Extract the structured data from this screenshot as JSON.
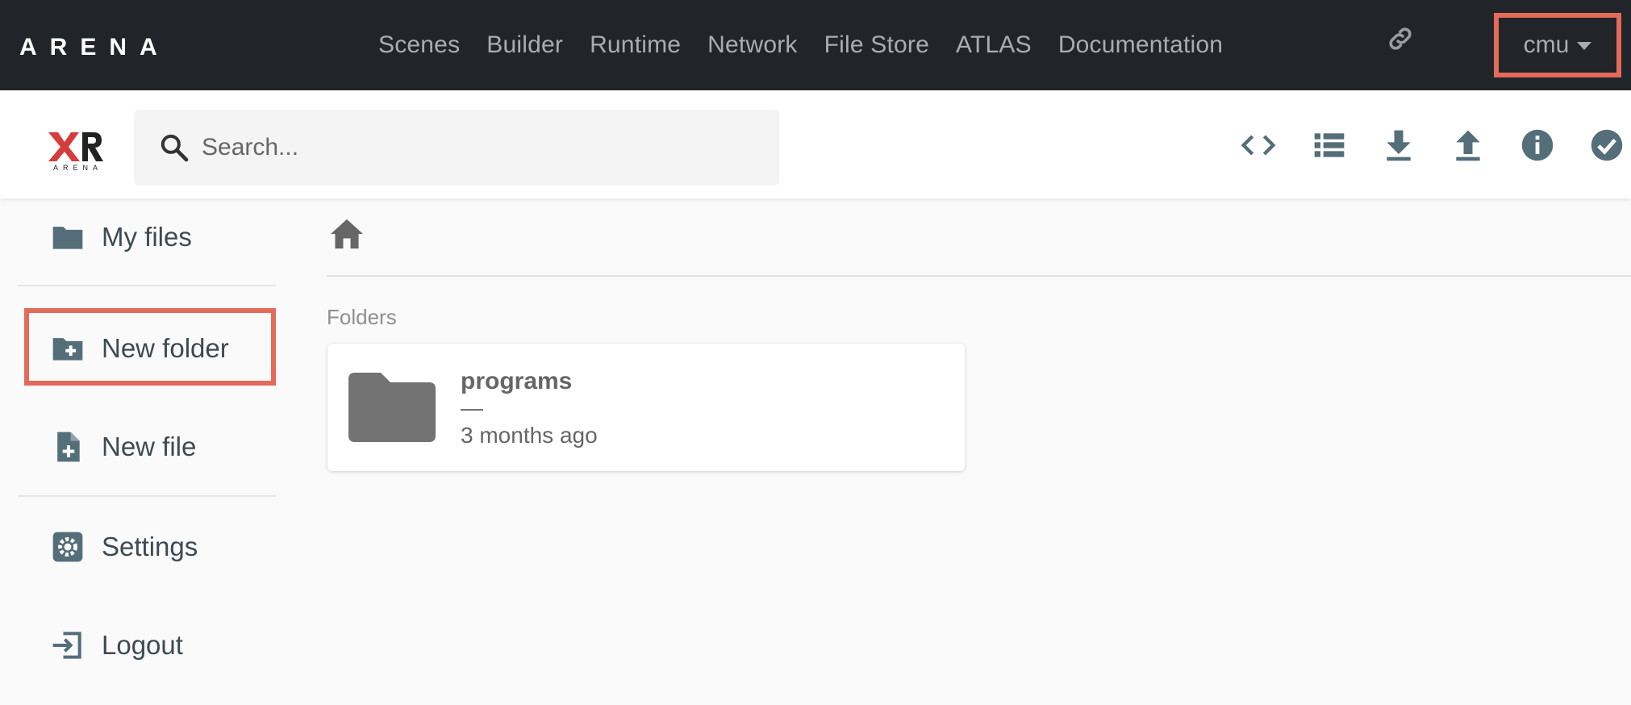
{
  "topnav": {
    "brand": "ARENA",
    "links": [
      "Scenes",
      "Builder",
      "Runtime",
      "Network",
      "File Store",
      "ATLAS",
      "Documentation"
    ],
    "user": "cmu",
    "icons": {
      "link": "link-icon",
      "caret": "caret-down-icon"
    }
  },
  "header": {
    "logo": "XR ARENA",
    "search": {
      "placeholder": "Search...",
      "value": ""
    },
    "toolbar_icons": [
      "code-icon",
      "list-view-icon",
      "download-icon",
      "upload-icon",
      "info-icon",
      "check-circle-icon"
    ]
  },
  "sidebar": {
    "items": [
      {
        "label": "My files",
        "icon": "folder-icon"
      },
      {
        "label": "New folder",
        "icon": "create-folder-icon"
      },
      {
        "label": "New file",
        "icon": "note-add-icon"
      },
      {
        "label": "Settings",
        "icon": "settings-icon"
      },
      {
        "label": "Logout",
        "icon": "logout-icon"
      }
    ]
  },
  "main": {
    "breadcrumb_icon": "home-icon",
    "section_title": "Folders",
    "folders": [
      {
        "name": "programs",
        "size": "—",
        "modified": "3 months ago",
        "icon": "folder-icon"
      }
    ]
  },
  "colors": {
    "navbar": "#212529",
    "highlight": "#e46a5a",
    "icon": "#546e7a",
    "xr_red": "#d63c3c"
  }
}
